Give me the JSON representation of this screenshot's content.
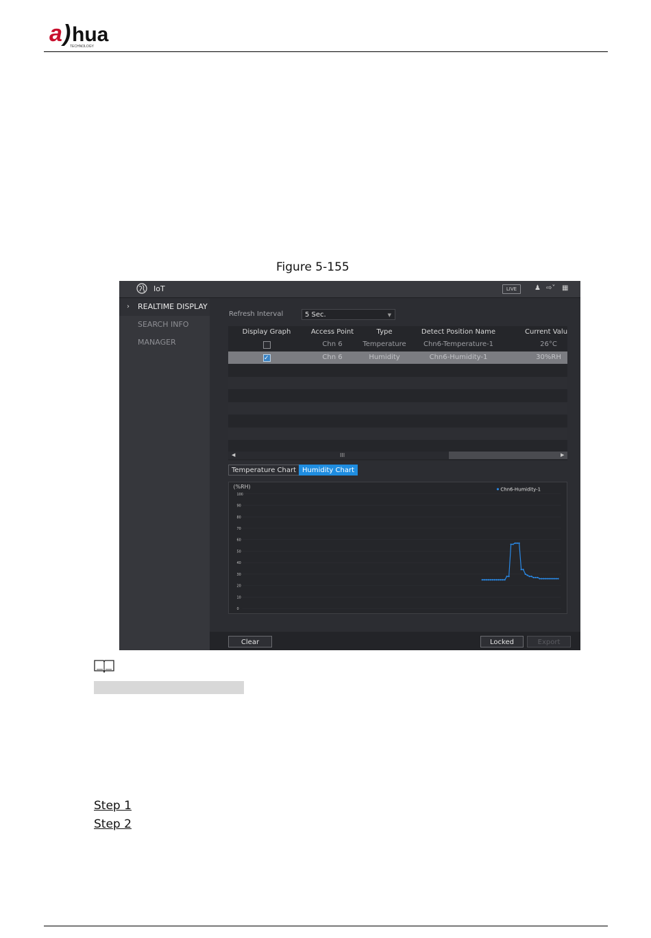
{
  "header": {
    "logo_text": "alhua",
    "logo_subtext": "TECHNOLOGY",
    "brand_color": "#c8102e"
  },
  "caption": "Figure 5-155",
  "screenshot": {
    "app_title": "IoT",
    "live_badge": "LIVE",
    "toolbar_icons": [
      "user-icon",
      "logout-icon",
      "grid-icon"
    ],
    "sidebar": {
      "items": [
        {
          "label": "REALTIME DISPLAY",
          "active": true
        },
        {
          "label": "SEARCH INFO",
          "active": false
        },
        {
          "label": "MANAGER",
          "active": false
        }
      ]
    },
    "refresh": {
      "label": "Refresh Interval",
      "value": "5 Sec."
    },
    "table": {
      "columns": [
        "Display Graph",
        "Access Point",
        "Type",
        "Detect Position Name",
        "Current Valu"
      ],
      "rows": [
        {
          "checked": false,
          "access_point": "Chn 6",
          "type": "Temperature",
          "position": "Chn6-Temperature-1",
          "value": "26°C",
          "selected": false
        },
        {
          "checked": true,
          "access_point": "Chn 6",
          "type": "Humidity",
          "position": "Chn6-Humidity-1",
          "value": "30%RH",
          "selected": true
        }
      ],
      "scroll_mark": "III"
    },
    "tabs": [
      {
        "label": "Temperature Chart",
        "active": false
      },
      {
        "label": "Humidity Chart",
        "active": true
      }
    ],
    "buttons": {
      "clear": "Clear",
      "locked": "Locked",
      "export": "Export"
    }
  },
  "chart_data": {
    "type": "line",
    "ylabel": "(%RH)",
    "ylim": [
      0,
      100
    ],
    "yticks": [
      "100",
      "90",
      "80",
      "70",
      "60",
      "50",
      "40",
      "30",
      "20",
      "10",
      "0"
    ],
    "series": [
      {
        "name": "Chn6-Humidity-1",
        "color": "#2a8ae8",
        "values": [
          25,
          25,
          25,
          25,
          25,
          25,
          25,
          25,
          25,
          25,
          25,
          25,
          28,
          28,
          56,
          56,
          57,
          57,
          57,
          34,
          34,
          30,
          29,
          28,
          28,
          27,
          27,
          27,
          26,
          26,
          26,
          26,
          26,
          26,
          26,
          26,
          26,
          26
        ]
      }
    ]
  },
  "steps": [
    "Step 1",
    "Step 2"
  ]
}
